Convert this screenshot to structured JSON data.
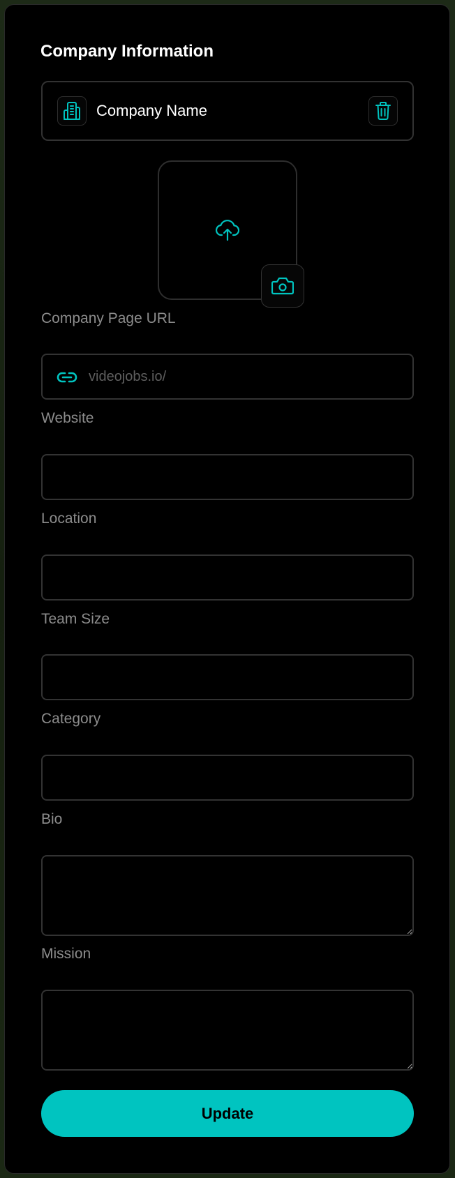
{
  "header": {
    "title": "Company Information"
  },
  "company": {
    "name_label": "Company Name"
  },
  "fields": {
    "page_url": {
      "label": "Company Page URL",
      "placeholder": "videojobs.io/"
    },
    "website": {
      "label": "Website",
      "value": ""
    },
    "location": {
      "label": "Location",
      "value": ""
    },
    "team_size": {
      "label": "Team Size",
      "value": ""
    },
    "category": {
      "label": "Category",
      "value": ""
    },
    "bio": {
      "label": "Bio",
      "value": ""
    },
    "mission": {
      "label": "Mission",
      "value": ""
    }
  },
  "actions": {
    "update_label": "Update"
  },
  "icons": {
    "building": "building-icon",
    "trash": "trash-icon",
    "upload": "cloud-upload-icon",
    "camera": "camera-icon",
    "link": "link-icon"
  },
  "colors": {
    "accent": "#00c4c0",
    "background": "#000000",
    "border": "#333333",
    "label": "#8c8c8c"
  }
}
